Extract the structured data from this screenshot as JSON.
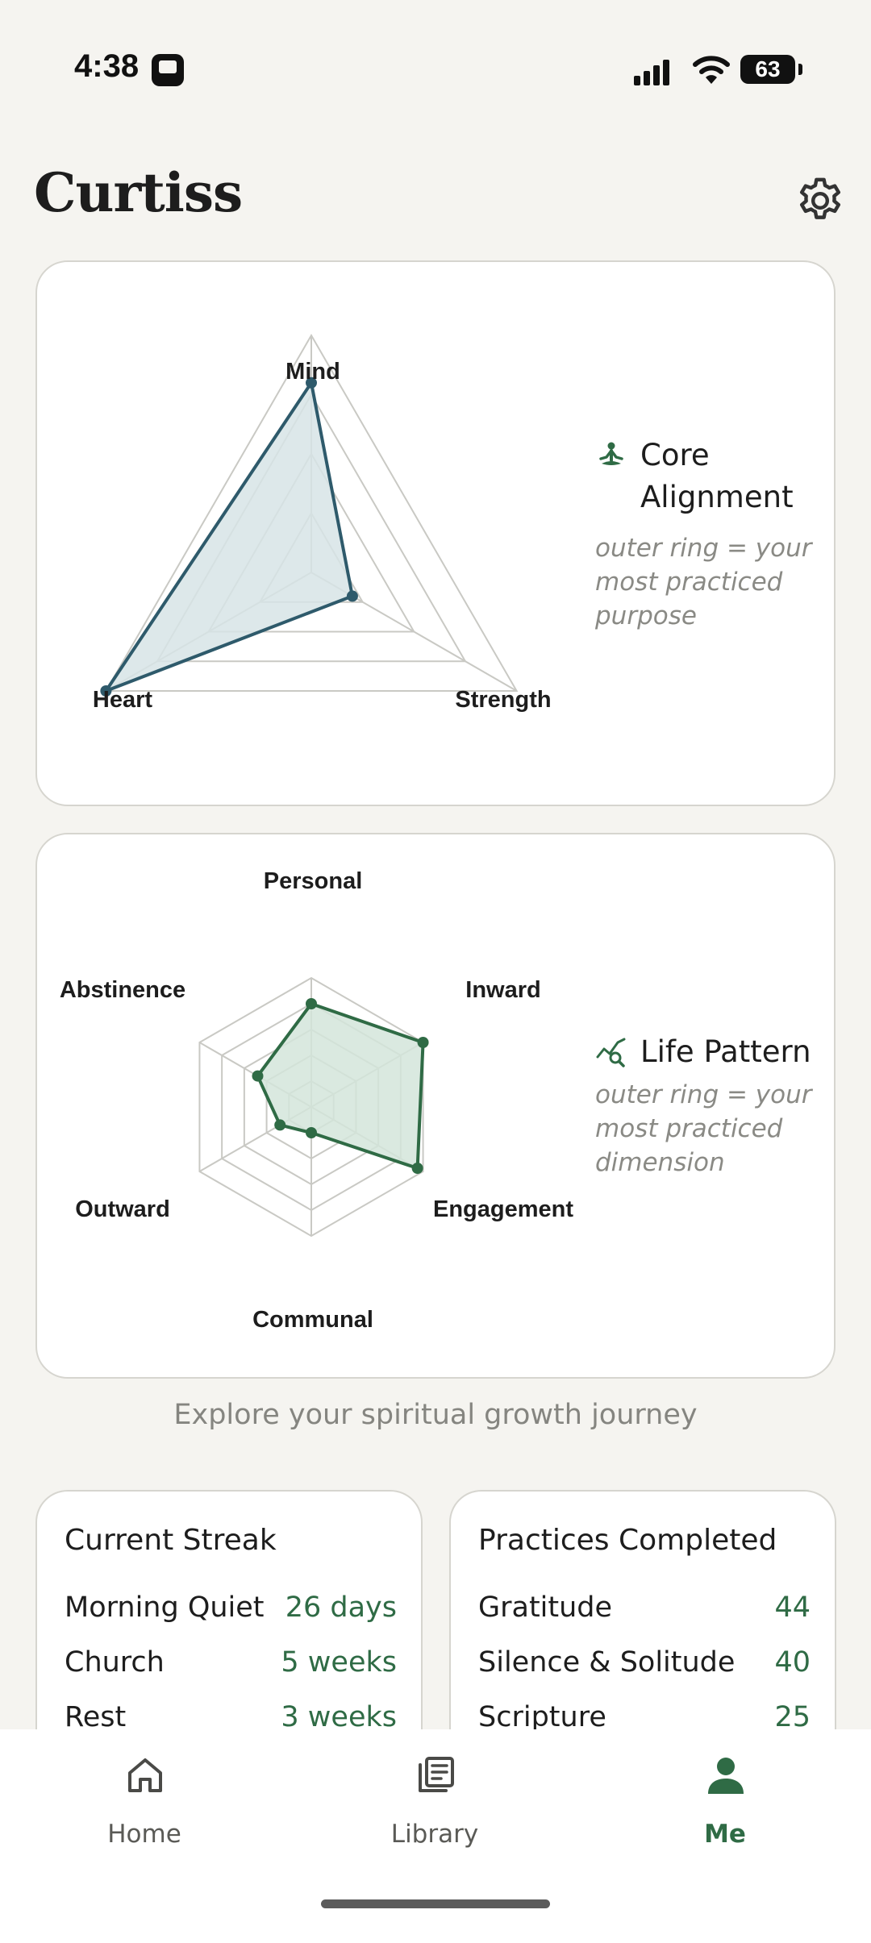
{
  "status_bar": {
    "time": "4:38",
    "battery": "63"
  },
  "header": {
    "title": "Curtiss",
    "settings_icon": "gear-icon"
  },
  "core_alignment": {
    "title": "Core Alignment",
    "title_line1": "Core",
    "title_line2": "Alignment",
    "desc_lines": [
      "outer ring = your",
      "most practiced",
      "purpose"
    ],
    "icon": "meditation-icon",
    "axes": [
      "Mind",
      "Strength",
      "Heart"
    ],
    "values": [
      0.8,
      0.2,
      1.0
    ],
    "color": "#2e5a6b",
    "fill": "#d7e4e6"
  },
  "life_pattern": {
    "title": "Life Pattern",
    "desc_lines": [
      "outer ring = your",
      "most practiced",
      "dimension"
    ],
    "icon": "trend-search-icon",
    "axes": [
      "Personal",
      "Inward",
      "Engagement",
      "Communal",
      "Outward",
      "Abstinence"
    ],
    "values": [
      0.8,
      1.0,
      0.95,
      0.2,
      0.28,
      0.48
    ],
    "color": "#2f6b45",
    "fill": "#d3e5da"
  },
  "subtitle": "Explore your spiritual growth journey",
  "current_streak": {
    "title": "Current Streak",
    "rows": [
      {
        "name": "Morning Quiet",
        "value": "26 days"
      },
      {
        "name": "Church",
        "value": "5 weeks"
      },
      {
        "name": "Rest",
        "value": "3 weeks"
      }
    ]
  },
  "practices_completed": {
    "title": "Practices Completed",
    "rows": [
      {
        "name": "Gratitude",
        "value": "44"
      },
      {
        "name": "Silence & Solitude",
        "value": "40"
      },
      {
        "name": "Scripture",
        "value": "25"
      }
    ]
  },
  "nav": {
    "home": "Home",
    "library": "Library",
    "me": "Me",
    "active": "me"
  }
}
